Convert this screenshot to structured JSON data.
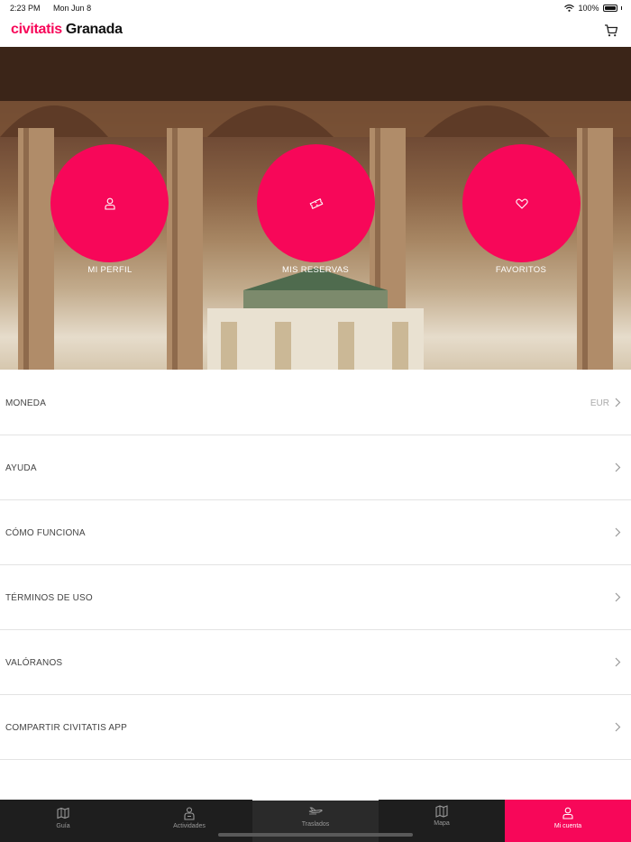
{
  "status_bar": {
    "time": "2:23 PM",
    "date": "Mon Jun 8",
    "battery": "100%"
  },
  "header": {
    "brand": "civitatis",
    "city": "Granada"
  },
  "hero": {
    "buttons": [
      {
        "label": "MI PERFIL",
        "icon": "user-icon"
      },
      {
        "label": "MIS RESERVAS",
        "icon": "ticket-icon"
      },
      {
        "label": "FAVORITOS",
        "icon": "heart-icon"
      }
    ]
  },
  "menu": {
    "items": [
      {
        "label": "MONEDA",
        "value": "EUR"
      },
      {
        "label": "AYUDA",
        "value": ""
      },
      {
        "label": "CÓMO FUNCIONA",
        "value": ""
      },
      {
        "label": "TÉRMINOS DE USO",
        "value": ""
      },
      {
        "label": "VALÓRANOS",
        "value": ""
      },
      {
        "label": "COMPARTIR CIVITATIS APP",
        "value": ""
      }
    ]
  },
  "tabs": [
    {
      "label": "Guía",
      "icon": "map-book-icon"
    },
    {
      "label": "Actividades",
      "icon": "guide-person-icon"
    },
    {
      "label": "Traslados",
      "icon": "plane-icon"
    },
    {
      "label": "Mapa",
      "icon": "map-icon"
    },
    {
      "label": "Mi cuenta",
      "icon": "user-icon"
    }
  ],
  "colors": {
    "accent": "#f70759",
    "tab_bar": "#1e1e1e"
  }
}
